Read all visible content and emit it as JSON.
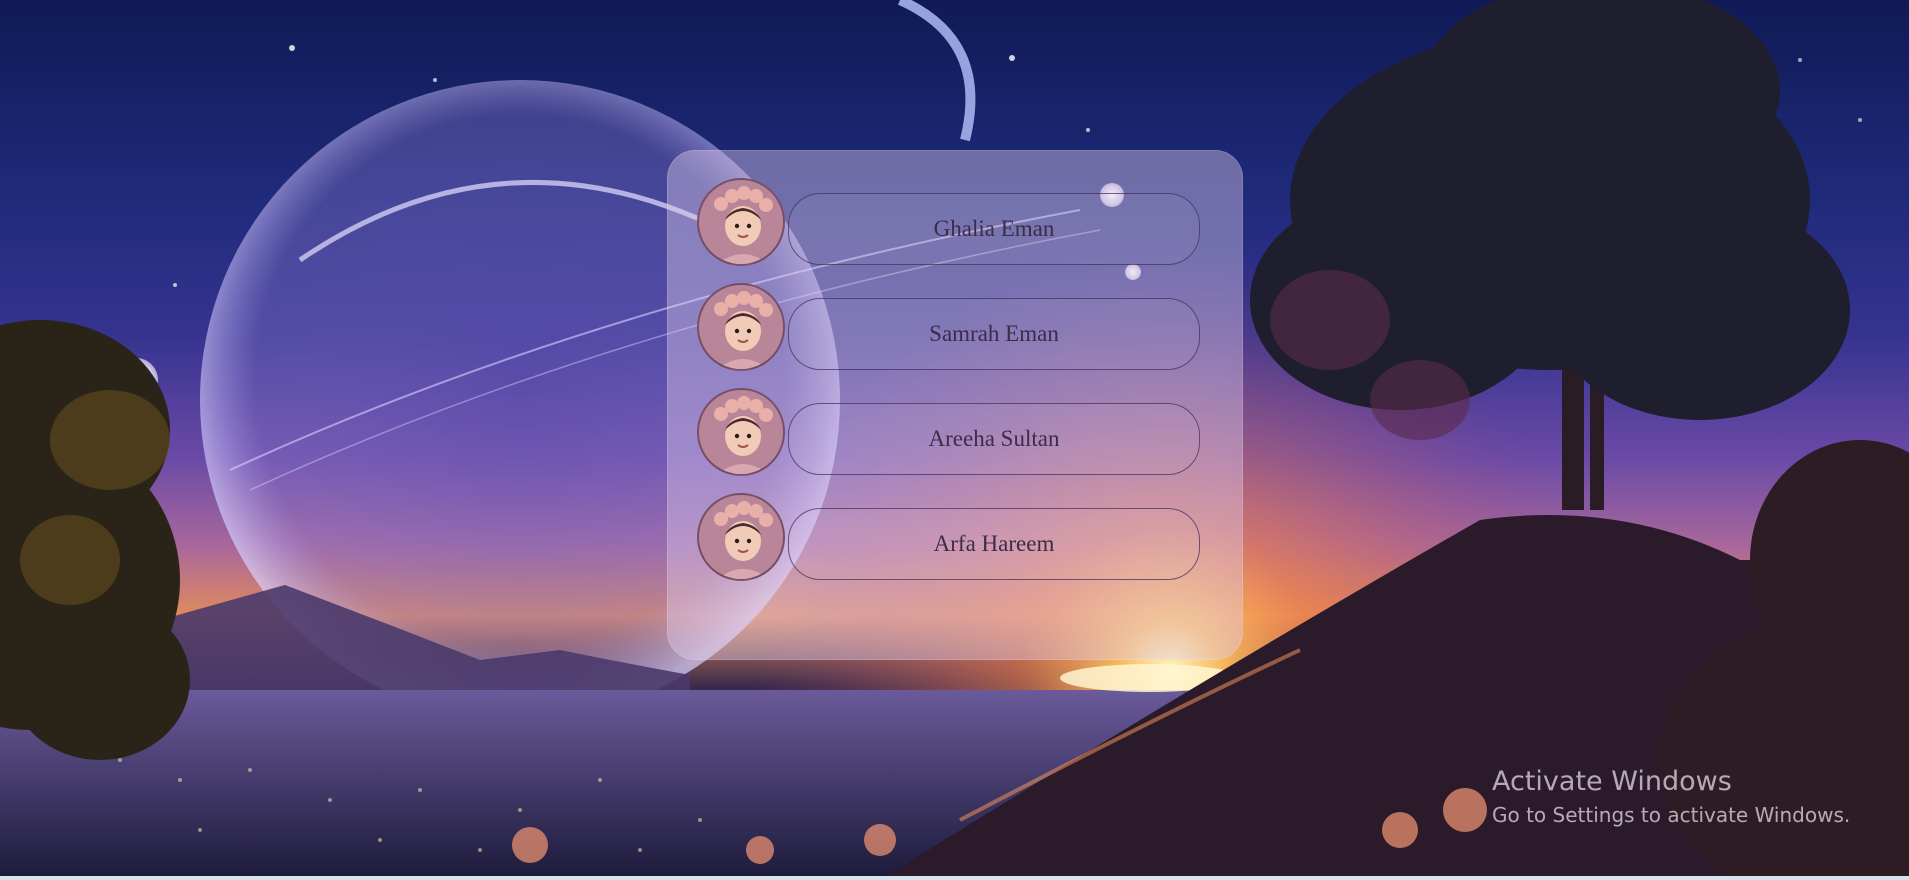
{
  "profiles": [
    {
      "name": "Ghalia Eman",
      "avatar_icon": "baby-portrait"
    },
    {
      "name": "Samrah Eman",
      "avatar_icon": "baby-portrait"
    },
    {
      "name": "Areeha Sultan",
      "avatar_icon": "baby-portrait"
    },
    {
      "name": "Arfa Hareem",
      "avatar_icon": "baby-portrait"
    }
  ],
  "watermark": {
    "title": "Activate Windows",
    "subtitle": "Go to Settings to activate Windows."
  },
  "colors": {
    "card": "#e1cdeb",
    "pill_border": "#46325a",
    "name_text": "#3d2b4a",
    "sky_top": "#0f1a55",
    "sunset": "#e08a5c"
  }
}
